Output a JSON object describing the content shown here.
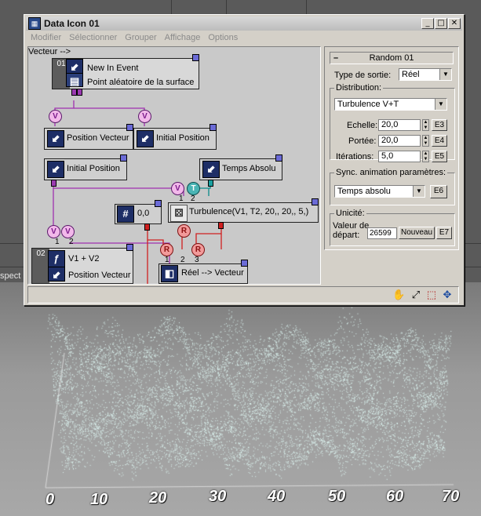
{
  "window": {
    "title": "Data Icon 01",
    "controls": {
      "minimize": "_",
      "maximize": "□",
      "close": "✕"
    }
  },
  "menu": [
    "Modifier",
    "Sélectionner",
    "Grouper",
    "Affichage",
    "Options"
  ],
  "graph": {
    "nodes": {
      "event": {
        "number": "01",
        "line1": "New In Event",
        "line2": "Point aléatoire de la surface"
      },
      "pos_vector": {
        "label": "Position Vecteur"
      },
      "init_pos_a": {
        "label": "Initial Position"
      },
      "init_pos_b": {
        "label": "Initial Position"
      },
      "temps_absolu": {
        "label": "Temps Absolu"
      },
      "turbulence": {
        "label": "Turbulence(V1, T2, 20,, 20,, 5,)"
      },
      "constant": {
        "label": "0,0"
      },
      "reel_vecteur": {
        "label": "Réel --> Vecteur"
      },
      "output": {
        "number": "02",
        "line1": "V1 + V2",
        "line2": "Position Vecteur"
      }
    },
    "converters": {
      "v": "V",
      "t": "T",
      "r": "R"
    },
    "port_numbers": {
      "one": "1",
      "two": "2",
      "three": "3"
    }
  },
  "panel": {
    "header": "Random 01",
    "output_type": {
      "label": "Type de sortie:",
      "value": "Réel"
    },
    "distribution": {
      "label": "Distribution:",
      "value": "Turbulence V+T"
    },
    "echelle": {
      "label": "Echelle:",
      "value": "20,0",
      "button": "E3"
    },
    "portee": {
      "label": "Portée:",
      "value": "20,0",
      "button": "E4"
    },
    "iterations": {
      "label": "Itérations:",
      "value": "5,0",
      "button": "E5"
    },
    "sync": {
      "label": "Sync. animation paramètres:",
      "value": "Temps absolu",
      "button": "E6"
    },
    "unicite": {
      "label": "Unicité:",
      "seed_label_1": "Valeur de",
      "seed_label_2": "départ:",
      "value": "26599",
      "new_button": "Nouveau",
      "button": "E7"
    }
  },
  "viewport": {
    "label": "spect",
    "axis_ticks": [
      "0",
      "10",
      "20",
      "30",
      "40",
      "50",
      "60",
      "70"
    ]
  },
  "colors": {
    "particle": "#dff8f4",
    "window_bg": "#d4d0c8"
  }
}
